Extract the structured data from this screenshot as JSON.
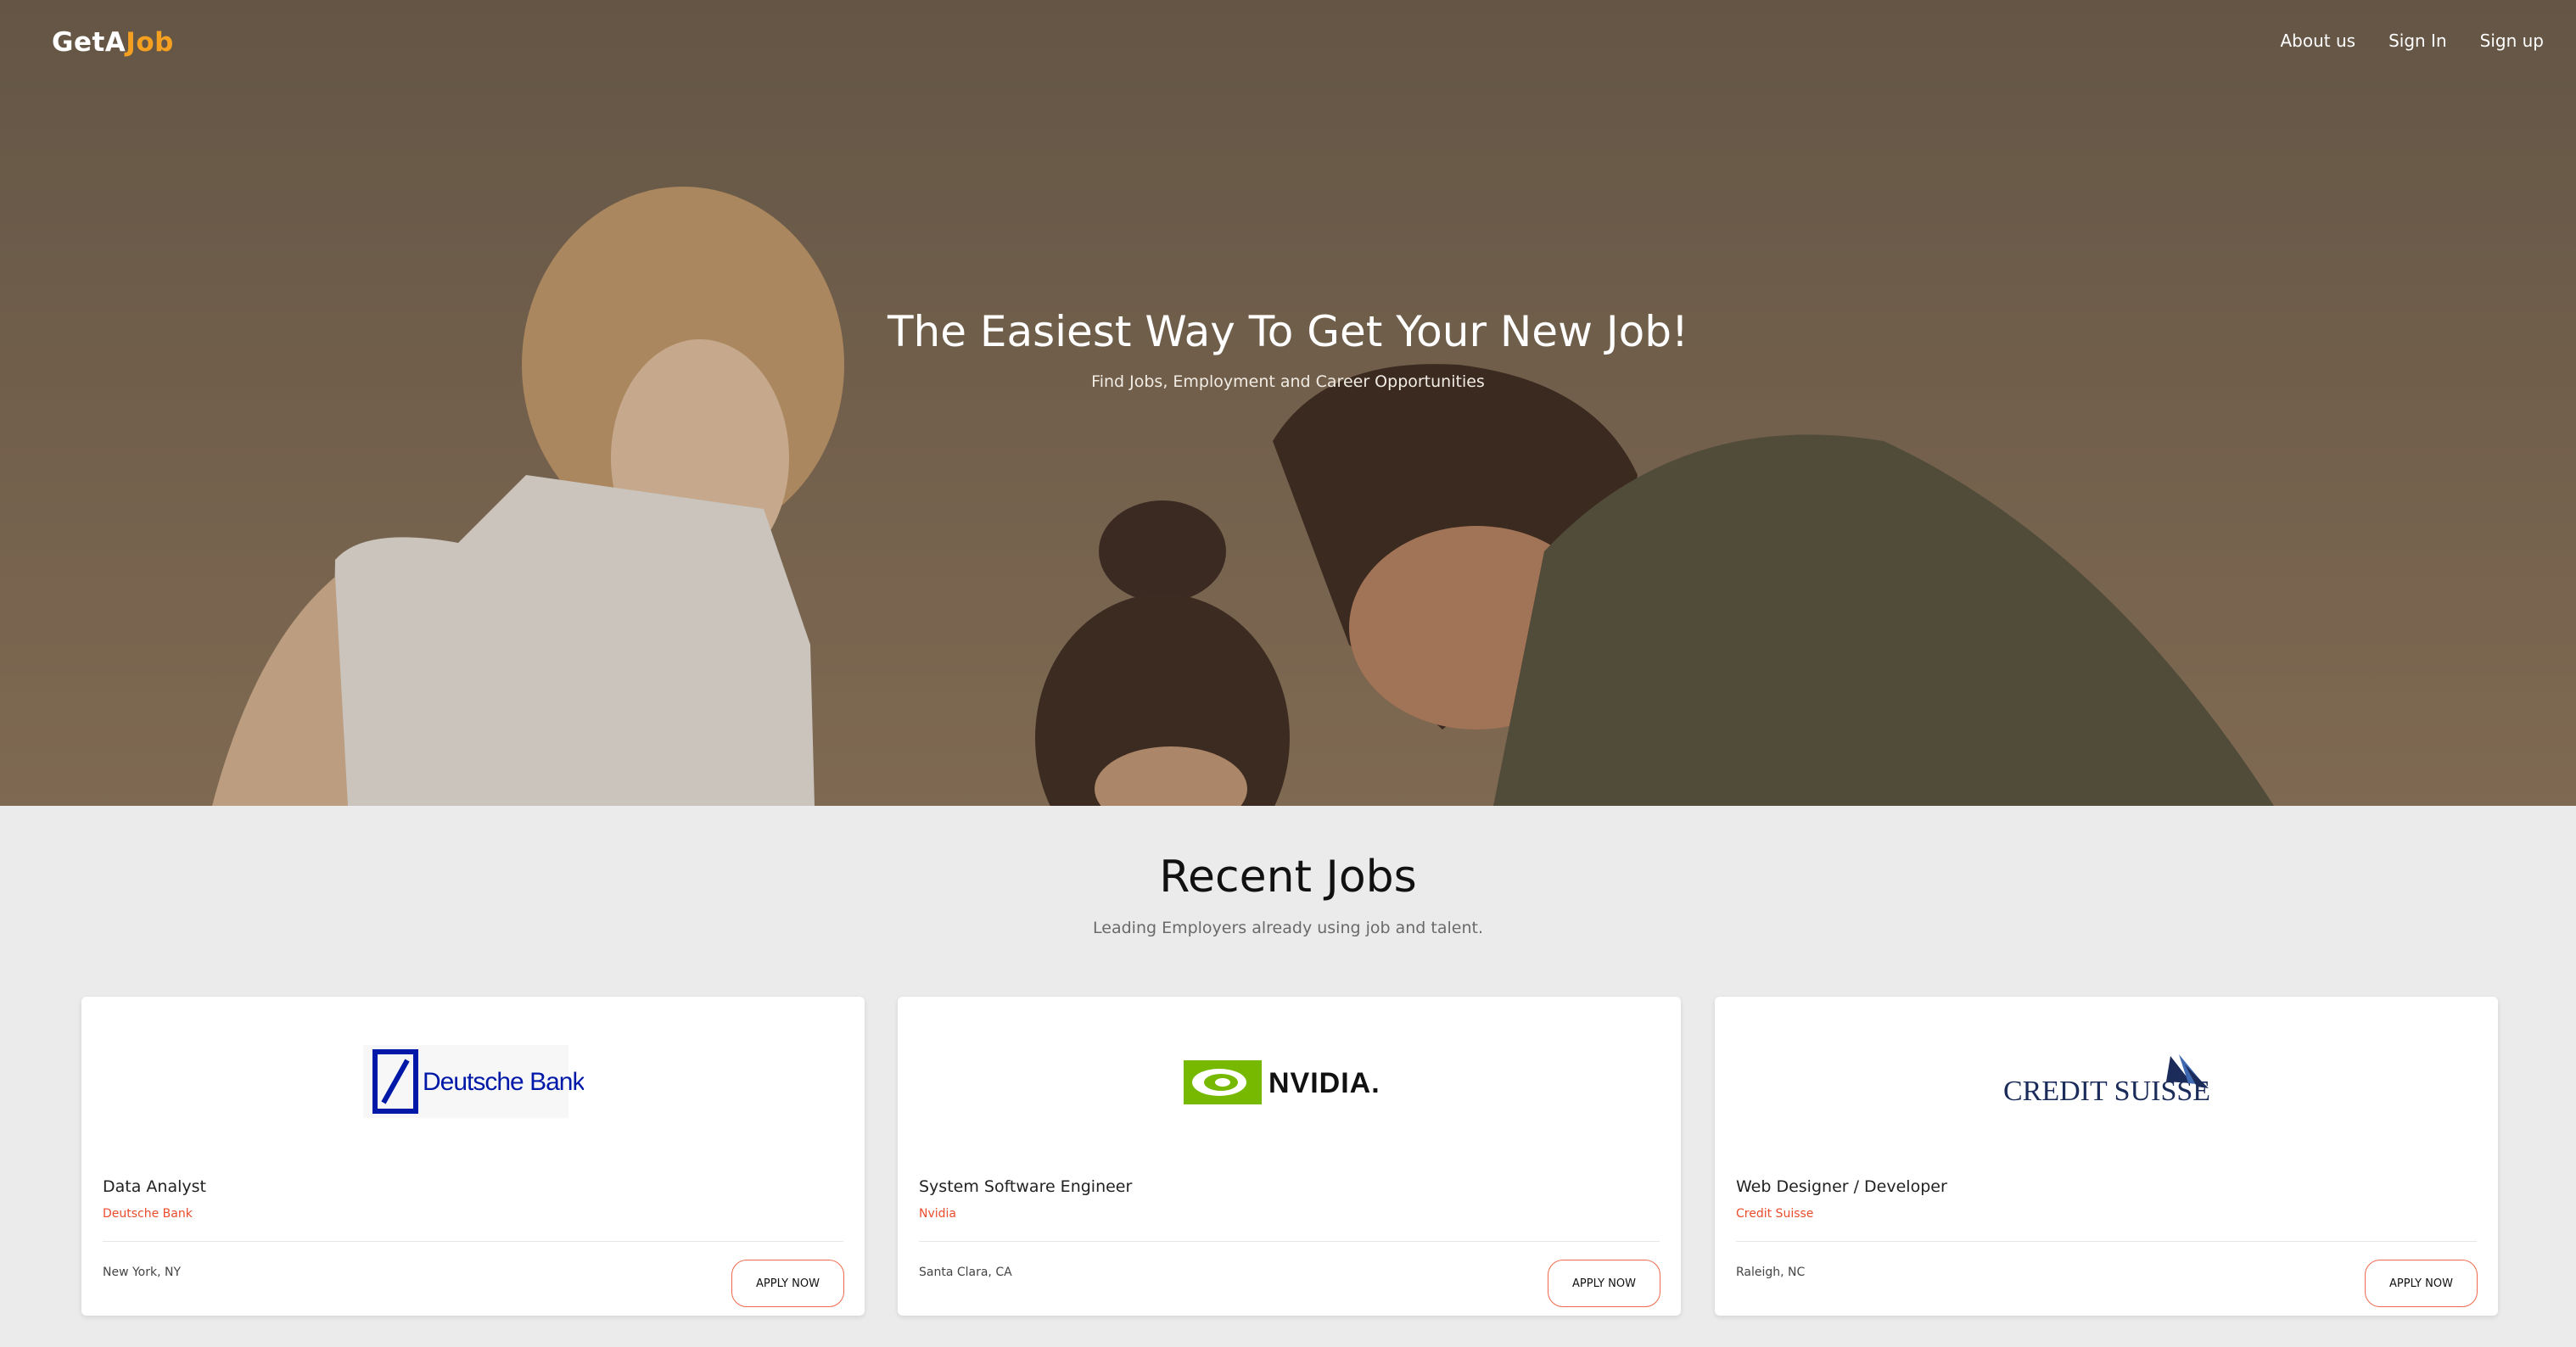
{
  "brand": {
    "part1": "GetA",
    "part2": "Job"
  },
  "nav": {
    "about": "About us",
    "signin": "Sign In",
    "signup": "Sign up"
  },
  "hero": {
    "title": "The Easiest Way To Get Your New Job!",
    "subtitle": "Find Jobs, Employment and Career Opportunities"
  },
  "recent": {
    "title": "Recent Jobs",
    "subtitle": "Leading Employers already using job and talent."
  },
  "jobs": [
    {
      "logo_text": "Deutsche Bank",
      "title": "Data Analyst",
      "company": "Deutsche Bank",
      "location": "New York, NY",
      "apply": "APPLY NOW"
    },
    {
      "logo_text": "NVIDIA.",
      "title": "System Software Engineer",
      "company": "Nvidia",
      "location": "Santa Clara, CA",
      "apply": "APPLY NOW"
    },
    {
      "logo_text": "CREDIT SUISSE",
      "title": "Web Designer / Developer",
      "company": "Credit Suisse",
      "location": "Raleigh, NC",
      "apply": "APPLY NOW"
    }
  ],
  "colors": {
    "accent": "#ea4c2c",
    "brand_orange": "#f5a020",
    "hero_bg": "#75644f",
    "nvidia_green": "#76b900",
    "deutsche_blue": "#0018a8",
    "credit_suisse_navy": "#1b2c5a"
  }
}
